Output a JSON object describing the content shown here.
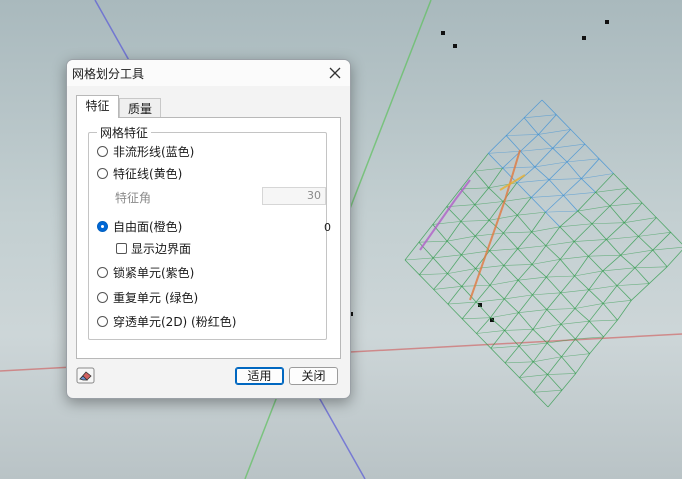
{
  "dialog": {
    "title": "网格划分工具",
    "close_icon": "close-icon",
    "tabs": [
      {
        "label": "特征",
        "active": true
      },
      {
        "label": "质量",
        "active": false
      }
    ],
    "group_title": "网格特征",
    "options": {
      "non_manifold": {
        "label": "非流形线(蓝色)",
        "checked": false
      },
      "feature_line": {
        "label": "特征线(黄色)",
        "checked": false
      },
      "feature_angle": {
        "label": "特征角",
        "value": "30",
        "enabled": false
      },
      "free_face": {
        "label": "自由面(橙色)",
        "checked": true,
        "count": "0"
      },
      "show_boundary": {
        "label": "显示边界面",
        "checked": false
      },
      "locked_element": {
        "label": "锁紧单元(紫色)",
        "checked": false
      },
      "duplicate_element": {
        "label": "重复单元 (绿色)",
        "checked": false
      },
      "penetrating_element": {
        "label": "穿透单元(2D) (粉红色)",
        "checked": false
      }
    },
    "eraser_icon": "eraser-icon",
    "apply_label": "适用",
    "close_label": "关闭"
  },
  "viewport": {
    "background": "#c3cfd1",
    "axis_colors": {
      "x": "#d06a6a",
      "y": "#5fc15f",
      "z": "#5a5ad8"
    },
    "mesh_colors": [
      "#2e9a4a",
      "#3a8fd6",
      "#e07a40",
      "#b060c8",
      "#e8b030"
    ]
  }
}
